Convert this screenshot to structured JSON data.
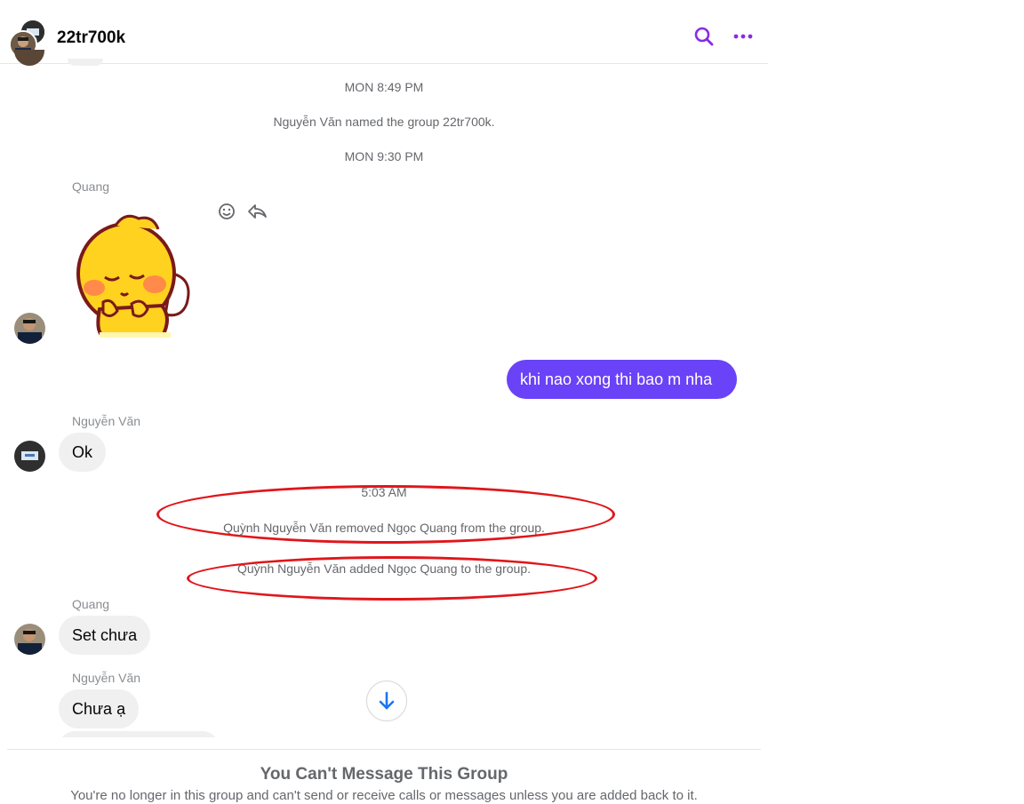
{
  "header": {
    "title": "22tr700k",
    "search_icon": "search-icon",
    "more_icon": "more-horizontal-icon",
    "accent": "#8a2be2"
  },
  "timeline": {
    "ts1": "MON 8:49 PM",
    "sys_named": "Nguyễn Văn named the group 22tr700k.",
    "ts2": "MON 9:30 PM",
    "sender_quang_1": "Quang",
    "sticker_icon": "sticker-image",
    "my_message": "khi nao xong thi bao m nha",
    "sender_nguyen_1": "Nguyễn Văn",
    "msg_ok": "Ok",
    "ts3": "5:03 AM",
    "sys_removed": "Quỳnh Nguyễn Văn removed Ngọc Quang from the group.",
    "sys_added": "Quỳnh Nguyễn Văn added Ngọc Quang to the group.",
    "sender_quang_2": "Quang",
    "msg_set": "Set chưa",
    "sender_nguyen_2": "Nguyễn Văn",
    "msg_chua": "Chưa ạ"
  },
  "footer": {
    "title": "You Can't Message This Group",
    "subtitle": "You're no longer in this group and can't send or receive calls or messages unless you are added back to it."
  },
  "colors": {
    "my_bubble": "#6a42f7",
    "annotation_ring": "#e0161b"
  }
}
